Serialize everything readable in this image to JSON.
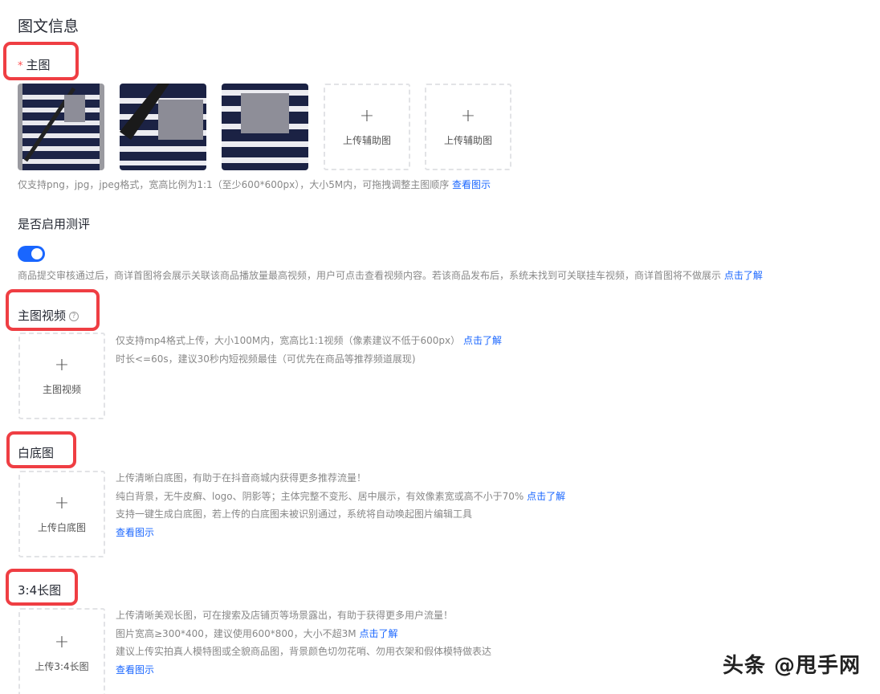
{
  "page": {
    "section_title": "图文信息"
  },
  "main_image": {
    "required_mark": "*",
    "label": "主图",
    "upload_slots": [
      {
        "plus": "+",
        "label": "上传辅助图"
      },
      {
        "plus": "+",
        "label": "上传辅助图"
      }
    ],
    "hint": "仅支持png，jpg，jpeg格式，宽高比例为1:1（至少600*600px），大小5M内，可拖拽调整主图顺序",
    "hint_link": "查看图示"
  },
  "review": {
    "label": "是否启用测评",
    "enabled": true,
    "hint": "商品提交审核通过后，商详首图将会展示关联该商品播放量最高视频，用户可点击查看视频内容。若该商品发布后，系统未找到可关联挂车视频，商详首图将不做展示",
    "hint_link": "点击了解"
  },
  "main_video": {
    "label": "主图视频",
    "help_icon": "?",
    "upload": {
      "plus": "+",
      "label": "主图视频"
    },
    "hint_line1": "仅支持mp4格式上传，大小100M内，宽高比1:1视频（像素建议不低于600px）",
    "hint_line1_link": "点击了解",
    "hint_line2": "时长<=60s，建议30秒内短视频最佳（可优先在商品等推荐频道展现)"
  },
  "white_bg": {
    "label": "白底图",
    "upload": {
      "plus": "+",
      "label": "上传白底图"
    },
    "hint_line1": "上传清晰白底图，有助于在抖音商城内获得更多推荐流量！",
    "hint_line2": "纯白背景，无牛皮癣、logo、阴影等；主体完整不变形、居中展示，有效像素宽或高不小于70%",
    "hint_line2_link": "点击了解",
    "hint_line3": "支持一键生成白底图，若上传的白底图未被识别通过，系统将自动唤起图片编辑工具",
    "hint_link": "查看图示"
  },
  "long_image": {
    "label": "3:4长图",
    "upload": {
      "plus": "+",
      "label": "上传3:4长图"
    },
    "hint_line1": "上传清晰美观长图，可在搜索及店铺页等场景露出，有助于获得更多用户流量！",
    "hint_line2": "图片宽高≥300*400，建议使用600*800，大小不超3M",
    "hint_line2_link": "点击了解",
    "hint_line3": "建议上传实拍真人模特图或全貌商品图，背景颜色切勿花哨、勿用衣架和假体模特做表达",
    "hint_link": "查看图示"
  },
  "watermark": "头条 @甩手网",
  "colors": {
    "accent": "#1966ff",
    "highlight": "#ef3e43",
    "required": "#ff4d4f"
  }
}
